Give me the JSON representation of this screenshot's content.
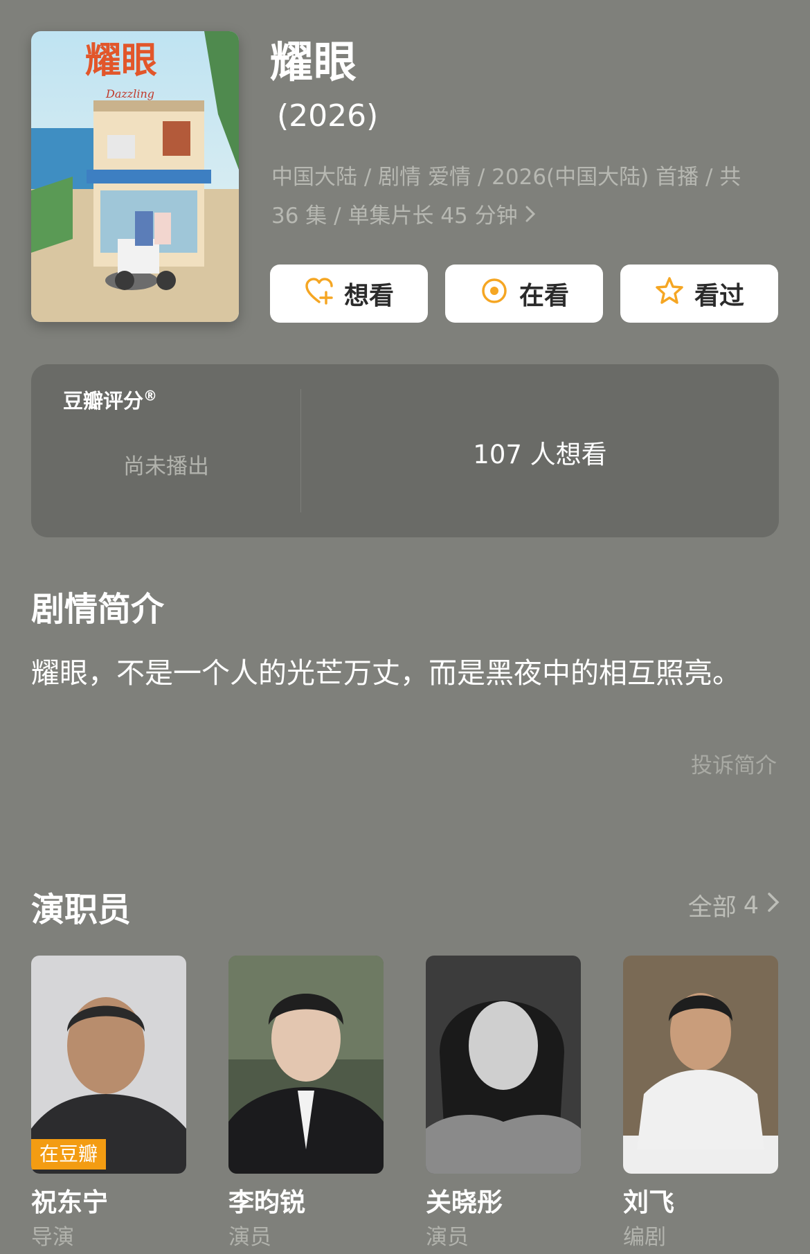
{
  "show": {
    "title": "耀眼",
    "year": "(2026)",
    "meta_line1": "中国大陆 / 剧情 爱情 / 2026(中国大陆) 首播 / 共",
    "meta_line2": "36 集 / 单集片长 45 分钟",
    "poster_title_art": "耀眼",
    "poster_subtitle": "Dazzling"
  },
  "actions": {
    "want": "想看",
    "watching": "在看",
    "watched": "看过"
  },
  "rating": {
    "label": "豆瓣评分",
    "mark": "®",
    "status": "尚未播出",
    "want_count": "107 人想看"
  },
  "synopsis": {
    "title": "剧情简介",
    "text": "耀眼，不是一个人的光芒万丈，而是黑夜中的相互照亮。",
    "report": "投诉简介"
  },
  "cast": {
    "title": "演职员",
    "all_label": "全部",
    "all_count": "4",
    "badge": "在豆瓣",
    "members": [
      {
        "name": "祝东宁",
        "role": "导演"
      },
      {
        "name": "李昀锐",
        "role": "演员"
      },
      {
        "name": "关晓彤",
        "role": "演员"
      },
      {
        "name": "刘飞",
        "role": "编剧"
      }
    ]
  },
  "colors": {
    "background": "#7f807b",
    "card": "#6a6b67",
    "accent_orange": "#f5a623",
    "badge": "#f39c12"
  }
}
